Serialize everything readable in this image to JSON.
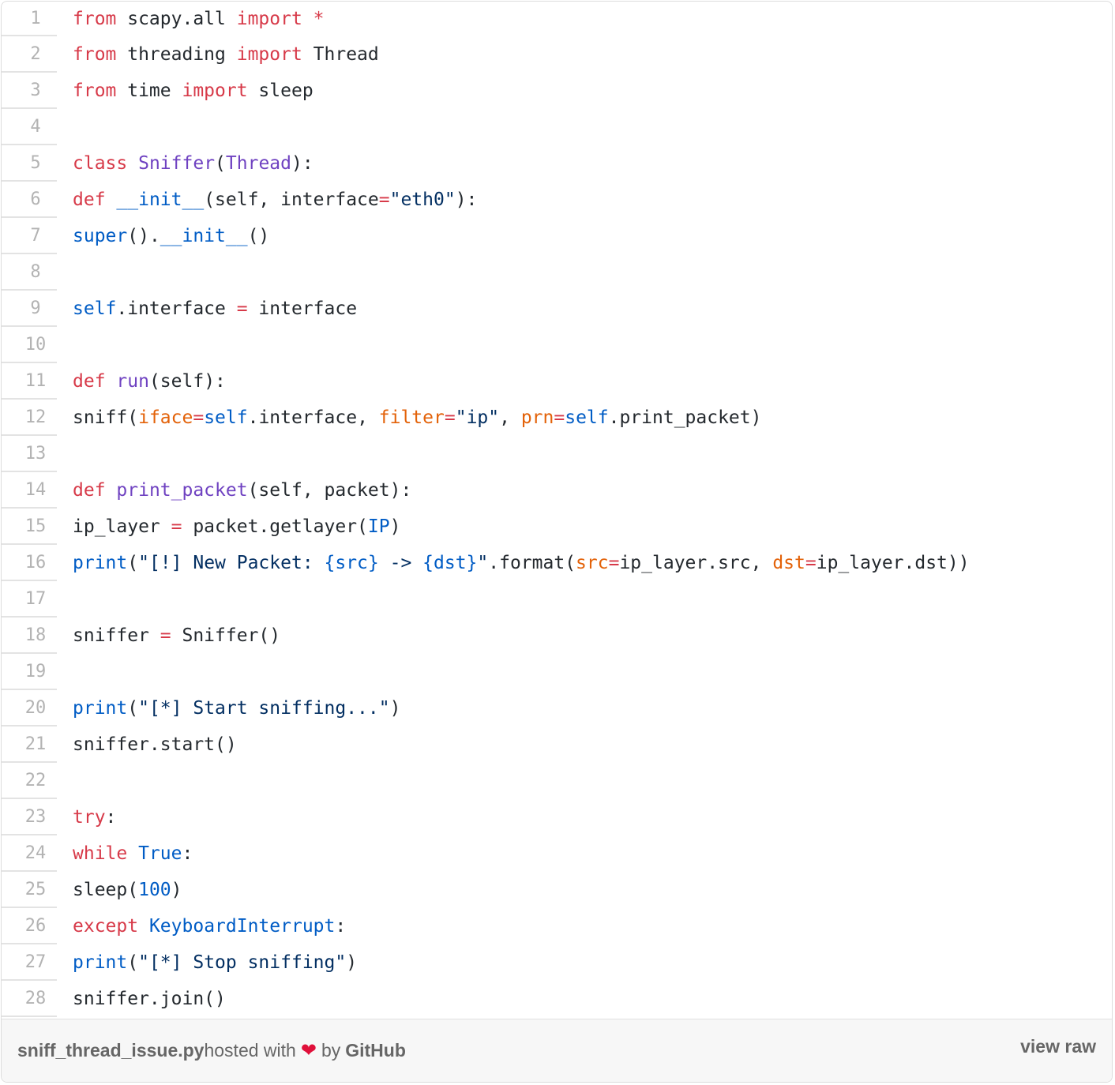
{
  "gist": {
    "lines": [
      {
        "num": "1",
        "tokens": [
          [
            "kw",
            "from"
          ],
          [
            "txt",
            " scapy.all "
          ],
          [
            "kw",
            "import"
          ],
          [
            "txt",
            " "
          ],
          [
            "kw",
            "*"
          ]
        ]
      },
      {
        "num": "2",
        "tokens": [
          [
            "kw",
            "from"
          ],
          [
            "txt",
            " threading "
          ],
          [
            "kw",
            "import"
          ],
          [
            "txt",
            " Thread"
          ]
        ]
      },
      {
        "num": "3",
        "tokens": [
          [
            "kw",
            "from"
          ],
          [
            "txt",
            " time "
          ],
          [
            "kw",
            "import"
          ],
          [
            "txt",
            " sleep"
          ]
        ]
      },
      {
        "num": "4",
        "tokens": []
      },
      {
        "num": "5",
        "tokens": [
          [
            "kw",
            "class"
          ],
          [
            "txt",
            " "
          ],
          [
            "cls",
            "Sniffer"
          ],
          [
            "txt",
            "("
          ],
          [
            "cls",
            "Thread"
          ],
          [
            "txt",
            "):"
          ]
        ]
      },
      {
        "num": "6",
        "tokens": [
          [
            "kw",
            "def"
          ],
          [
            "txt",
            " "
          ],
          [
            "bi",
            "__init__"
          ],
          [
            "txt",
            "(self, interface"
          ],
          [
            "op",
            "="
          ],
          [
            "str",
            "\"eth0\""
          ],
          [
            "txt",
            "):"
          ]
        ]
      },
      {
        "num": "7",
        "tokens": [
          [
            "bi",
            "super"
          ],
          [
            "txt",
            "()."
          ],
          [
            "bi",
            "__init__"
          ],
          [
            "txt",
            "()"
          ]
        ]
      },
      {
        "num": "8",
        "tokens": []
      },
      {
        "num": "9",
        "tokens": [
          [
            "bi",
            "self"
          ],
          [
            "txt",
            ".interface "
          ],
          [
            "op",
            "="
          ],
          [
            "txt",
            " interface"
          ]
        ]
      },
      {
        "num": "10",
        "tokens": []
      },
      {
        "num": "11",
        "tokens": [
          [
            "kw",
            "def"
          ],
          [
            "txt",
            " "
          ],
          [
            "fn",
            "run"
          ],
          [
            "txt",
            "(self):"
          ]
        ]
      },
      {
        "num": "12",
        "tokens": [
          [
            "txt",
            "sniff("
          ],
          [
            "arg",
            "iface"
          ],
          [
            "op",
            "="
          ],
          [
            "bi",
            "self"
          ],
          [
            "txt",
            ".interface, "
          ],
          [
            "arg",
            "filter"
          ],
          [
            "op",
            "="
          ],
          [
            "str",
            "\"ip\""
          ],
          [
            "txt",
            ", "
          ],
          [
            "arg",
            "prn"
          ],
          [
            "op",
            "="
          ],
          [
            "bi",
            "self"
          ],
          [
            "txt",
            ".print_packet)"
          ]
        ]
      },
      {
        "num": "13",
        "tokens": []
      },
      {
        "num": "14",
        "tokens": [
          [
            "kw",
            "def"
          ],
          [
            "txt",
            " "
          ],
          [
            "fn",
            "print_packet"
          ],
          [
            "txt",
            "(self, packet):"
          ]
        ]
      },
      {
        "num": "15",
        "tokens": [
          [
            "txt",
            "ip_layer "
          ],
          [
            "op",
            "="
          ],
          [
            "txt",
            " packet.getlayer("
          ],
          [
            "bi",
            "IP"
          ],
          [
            "txt",
            ")"
          ]
        ]
      },
      {
        "num": "16",
        "tokens": [
          [
            "bi",
            "print"
          ],
          [
            "txt",
            "("
          ],
          [
            "str",
            "\"[!] New Packet: "
          ],
          [
            "bi",
            "{src}"
          ],
          [
            "str",
            " -> "
          ],
          [
            "bi",
            "{dst}"
          ],
          [
            "str",
            "\""
          ],
          [
            "txt",
            ".format("
          ],
          [
            "arg",
            "src"
          ],
          [
            "op",
            "="
          ],
          [
            "txt",
            "ip_layer.src, "
          ],
          [
            "arg",
            "dst"
          ],
          [
            "op",
            "="
          ],
          [
            "txt",
            "ip_layer.dst))"
          ]
        ]
      },
      {
        "num": "17",
        "tokens": []
      },
      {
        "num": "18",
        "tokens": [
          [
            "txt",
            "sniffer "
          ],
          [
            "op",
            "="
          ],
          [
            "txt",
            " Sniffer()"
          ]
        ]
      },
      {
        "num": "19",
        "tokens": []
      },
      {
        "num": "20",
        "tokens": [
          [
            "bi",
            "print"
          ],
          [
            "txt",
            "("
          ],
          [
            "str",
            "\"[*] Start sniffing...\""
          ],
          [
            "txt",
            ")"
          ]
        ]
      },
      {
        "num": "21",
        "tokens": [
          [
            "txt",
            "sniffer.start()"
          ]
        ]
      },
      {
        "num": "22",
        "tokens": []
      },
      {
        "num": "23",
        "tokens": [
          [
            "kw",
            "try"
          ],
          [
            "txt",
            ":"
          ]
        ]
      },
      {
        "num": "24",
        "tokens": [
          [
            "kw",
            "while"
          ],
          [
            "txt",
            " "
          ],
          [
            "bi",
            "True"
          ],
          [
            "txt",
            ":"
          ]
        ]
      },
      {
        "num": "25",
        "tokens": [
          [
            "txt",
            "sleep("
          ],
          [
            "num",
            "100"
          ],
          [
            "txt",
            ")"
          ]
        ]
      },
      {
        "num": "26",
        "tokens": [
          [
            "kw",
            "except"
          ],
          [
            "txt",
            " "
          ],
          [
            "bi",
            "KeyboardInterrupt"
          ],
          [
            "txt",
            ":"
          ]
        ]
      },
      {
        "num": "27",
        "tokens": [
          [
            "bi",
            "print"
          ],
          [
            "txt",
            "("
          ],
          [
            "str",
            "\"[*] Stop sniffing\""
          ],
          [
            "txt",
            ")"
          ]
        ]
      },
      {
        "num": "28",
        "tokens": [
          [
            "txt",
            "sniffer.join()"
          ]
        ]
      }
    ]
  },
  "footer": {
    "filename": "sniff_thread_issue.py",
    "hosted_with": "hosted with",
    "heart": "❤",
    "by": "by",
    "github": "GitHub",
    "view_raw": "view raw"
  },
  "colors": {
    "keyword": "#d73a49",
    "class_name": "#6f42c1",
    "builtin": "#005cc5",
    "string": "#032f62",
    "argument": "#e36209",
    "text": "#24292e",
    "line_number": "#b3b3b3",
    "footer_bg": "#f7f7f7",
    "heart": "#e0103a"
  }
}
